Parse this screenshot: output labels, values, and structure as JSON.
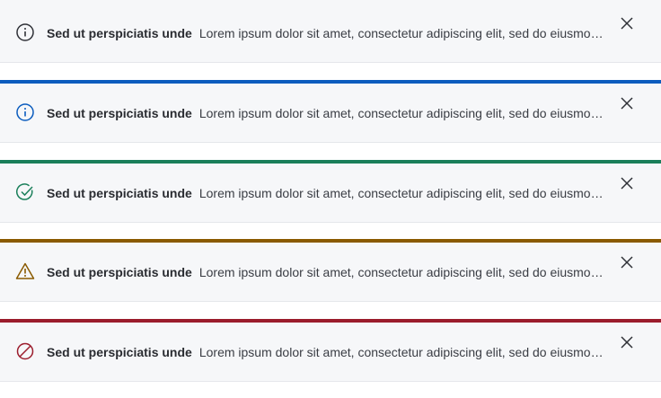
{
  "colors": {
    "neutral": "#2f3137",
    "info": "#0b5cbe",
    "success": "#1a7f5a",
    "warning": "#8a5a00",
    "error": "#9b1c2c",
    "banner_background": "#f6f7f9"
  },
  "banners": [
    {
      "variant": "neutral",
      "icon": "info-circle-icon",
      "title": "Sed ut perspiciatis unde",
      "message": "Lorem ipsum dolor sit amet, consectetur adipiscing elit, sed do eiusmod tempor incididunt ut labore et dolore magna aliqua.",
      "close_icon": "close-icon"
    },
    {
      "variant": "info",
      "icon": "info-circle-icon",
      "title": "Sed ut perspiciatis unde",
      "message": "Lorem ipsum dolor sit amet, consectetur adipiscing elit, sed do eiusmod tempor incididunt ut labore et dolore magna aliqua.",
      "close_icon": "close-icon"
    },
    {
      "variant": "success",
      "icon": "check-circle-icon",
      "title": "Sed ut perspiciatis unde",
      "message": "Lorem ipsum dolor sit amet, consectetur adipiscing elit, sed do eiusmod tempor incididunt ut labore et dolore magna aliqua.",
      "close_icon": "close-icon"
    },
    {
      "variant": "warning",
      "icon": "warning-triangle-icon",
      "title": "Sed ut perspiciatis unde",
      "message": "Lorem ipsum dolor sit amet, consectetur adipiscing elit, sed do eiusmod tempor incididunt ut labore et dolore magna aliqua.",
      "close_icon": "close-icon"
    },
    {
      "variant": "error",
      "icon": "blocked-circle-icon",
      "title": "Sed ut perspiciatis unde",
      "message": "Lorem ipsum dolor sit amet, consectetur adipiscing elit, sed do eiusmod tempor incididunt ut labore et dolore magna aliqua.",
      "close_icon": "close-icon"
    }
  ]
}
